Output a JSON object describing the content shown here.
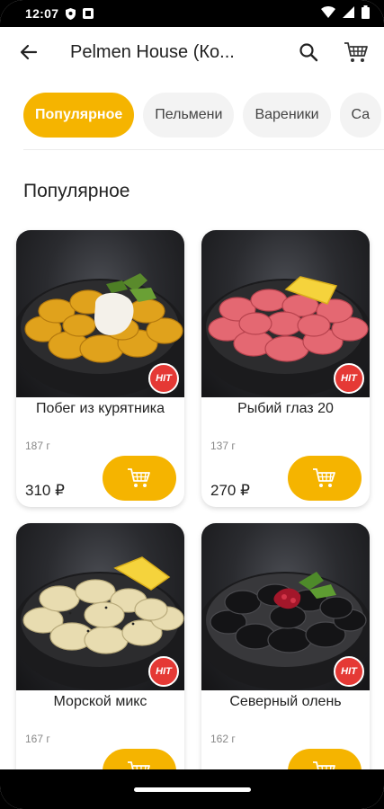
{
  "status_bar": {
    "time": "12:07",
    "icons": [
      "shield-icon",
      "square-icon",
      "wifi-icon",
      "signal-icon",
      "battery-icon"
    ]
  },
  "app_bar": {
    "title": "Pelmen House (Ко...",
    "back_icon": "arrow-left-icon",
    "search_icon": "search-icon",
    "cart_icon": "cart-icon"
  },
  "categories": [
    {
      "label": "Популярное",
      "active": true
    },
    {
      "label": "Пельмени",
      "active": false
    },
    {
      "label": "Вареники",
      "active": false
    },
    {
      "label": "Са",
      "active": false
    }
  ],
  "section_title": "Популярное",
  "products": [
    {
      "name": "Побег из курятника",
      "weight": "187 г",
      "price": "310 ₽",
      "badge": "HIT",
      "food_color": "#e0a21c"
    },
    {
      "name": "Рыбий глаз 20",
      "weight": "137 г",
      "price": "270 ₽",
      "badge": "HIT",
      "food_color": "#e46872"
    },
    {
      "name": "Морской микс",
      "weight": "167 г",
      "price": "",
      "badge": "HIT",
      "food_color": "#e8dcb0"
    },
    {
      "name": "Северный олень",
      "weight": "162 г",
      "price": "",
      "badge": "HIT",
      "food_color": "#1c1c1e"
    }
  ],
  "colors": {
    "accent": "#f5b400",
    "badge": "#e53935"
  }
}
